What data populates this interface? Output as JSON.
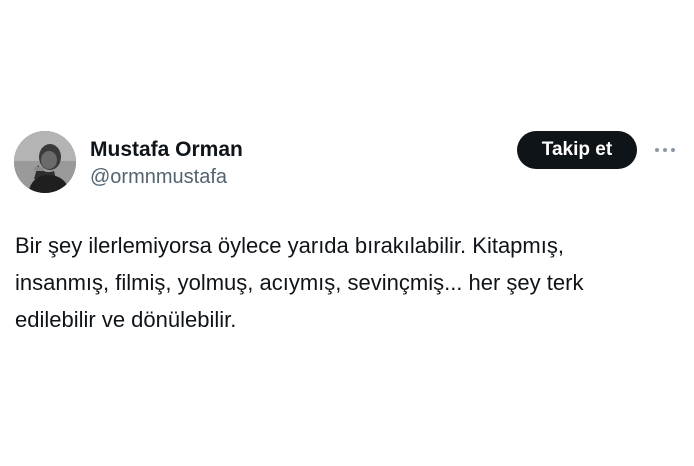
{
  "author": {
    "display_name": "Mustafa Orman",
    "handle": "@ormnmustafa",
    "avatar_icon": "profile-photo"
  },
  "actions": {
    "follow_label": "Takip et",
    "more_icon": "more-horizontal-icon"
  },
  "tweet": {
    "lines": [
      "Bir şey ilerlemiyorsa öylece yarıda bırakılabilir. Kitapmış,",
      "insanmış, filmiş, yolmuş, acıymış, sevinçmiş... her şey terk",
      "edilebilir ve dönülebilir."
    ]
  },
  "colors": {
    "text_primary": "#0f1419",
    "text_secondary": "#536471",
    "button_bg": "#0f1419",
    "button_text": "#ffffff"
  }
}
